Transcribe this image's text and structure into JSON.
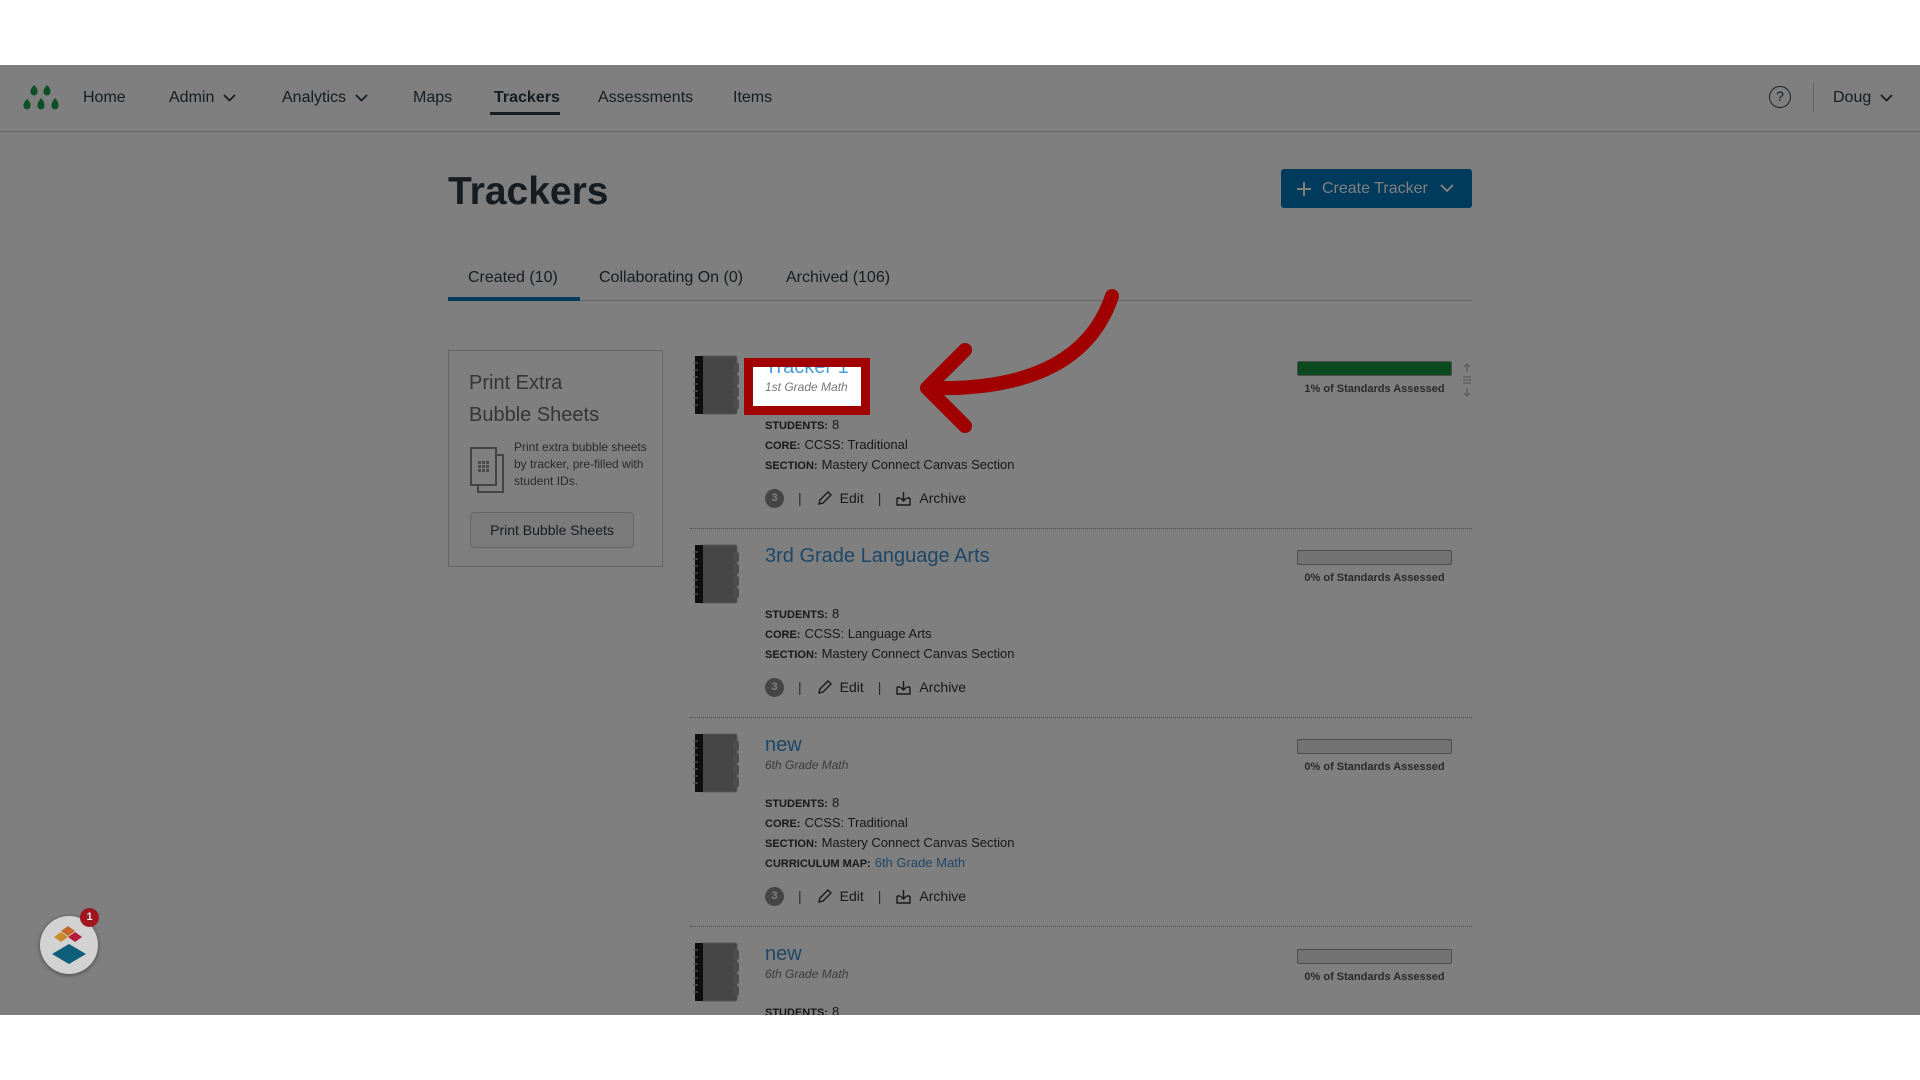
{
  "nav": {
    "items": [
      {
        "label": "Home"
      },
      {
        "label": "Admin",
        "dropdown": true
      },
      {
        "label": "Analytics",
        "dropdown": true
      },
      {
        "label": "Maps"
      },
      {
        "label": "Trackers",
        "active": true
      },
      {
        "label": "Assessments"
      },
      {
        "label": "Items"
      }
    ],
    "help_icon": "?",
    "user": "Doug"
  },
  "page": {
    "title": "Trackers",
    "create_button": "Create Tracker"
  },
  "tabs": [
    {
      "label": "Created (10)",
      "active": true
    },
    {
      "label": "Collaborating On (0)"
    },
    {
      "label": "Archived (106)"
    }
  ],
  "sidebar_card": {
    "title_line1": "Print Extra",
    "title_line2": "Bubble Sheets",
    "description": "Print extra bubble sheets by tracker, pre-filled with student IDs.",
    "button": "Print Bubble Sheets"
  },
  "labels": {
    "students": "STUDENTS:",
    "core": "CORE:",
    "section": "SECTION:",
    "curriculum_map": "CURRICULUM MAP:",
    "edit": "Edit",
    "archive": "Archive",
    "separator": "|"
  },
  "trackers": [
    {
      "title": "Tracker 1",
      "subtitle": "1st Grade Math",
      "students": "8",
      "core": "CCSS: Traditional",
      "section": "Mastery Connect Canvas Section",
      "count": "3",
      "progress_label": "1% of Standards Assessed",
      "bar_fill": 1.0
    },
    {
      "title": "3rd Grade Language Arts",
      "subtitle": "",
      "students": "8",
      "core": "CCSS: Language Arts",
      "section": "Mastery Connect Canvas Section",
      "count": "3",
      "progress_label": "0% of Standards Assessed",
      "bar_fill": 0
    },
    {
      "title": "new",
      "subtitle": "6th Grade Math",
      "students": "8",
      "core": "CCSS: Traditional",
      "section": "Mastery Connect Canvas Section",
      "curriculum_map": "6th Grade Math",
      "count": "3",
      "progress_label": "0% of Standards Assessed",
      "bar_fill": 0
    },
    {
      "title": "new",
      "subtitle": "6th Grade Math",
      "students": "8",
      "progress_label": "0% of Standards Assessed",
      "bar_fill": 0
    }
  ],
  "chat_widget": {
    "badge": "1"
  },
  "colors": {
    "brand_green": "#15943d",
    "primary_blue": "#0074b8",
    "link_blue": "#3b8fd0",
    "annotation_red": "#a00000"
  }
}
